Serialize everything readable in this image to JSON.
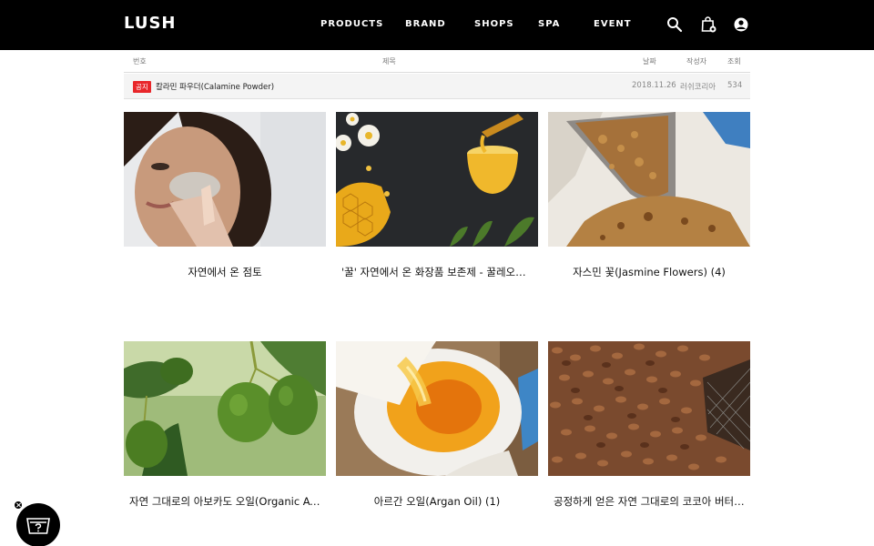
{
  "header": {
    "logo": "LUSH",
    "nav": [
      "PRODUCTS",
      "BRAND",
      "SHOPS",
      "SPA",
      "EVENT"
    ],
    "icons": [
      "search-icon",
      "shopping-bag-icon",
      "user-icon"
    ]
  },
  "table": {
    "headers": {
      "no": "번호",
      "title": "제목",
      "date": "날짜",
      "author": "작성자",
      "views": "조회"
    },
    "notice": {
      "badge": "공지",
      "title": "칼라민 파우더(Calamine Powder)",
      "date": "2018.11.26",
      "author": "러쉬코리아",
      "views": "534"
    }
  },
  "cards": [
    {
      "title": "자연에서 온 점토",
      "image": "woman applying clay mask"
    },
    {
      "title": "'꿀' 자연에서 온 화장품 보존제 - 꿀레오파…",
      "image": "honey bowl with honeycomb and flowers"
    },
    {
      "title": "자스민 꽃(Jasmine Flowers) (4)",
      "image": "scoop of dried jasmine flowers"
    },
    {
      "title": "자연 그대로의 아보카도 오일(Organic Av…",
      "image": "avocados on tree"
    },
    {
      "title": "아르간 오일(Argan Oil) (1)",
      "image": "argan oil pouring"
    },
    {
      "title": "공정하게 얻은 자연 그대로의 코코아 버터(…",
      "image": "cocoa beans drying"
    }
  ],
  "colors": {
    "header_bg": "#000000",
    "badge": "#e8262a",
    "notice_bg": "#f4f4f4"
  }
}
